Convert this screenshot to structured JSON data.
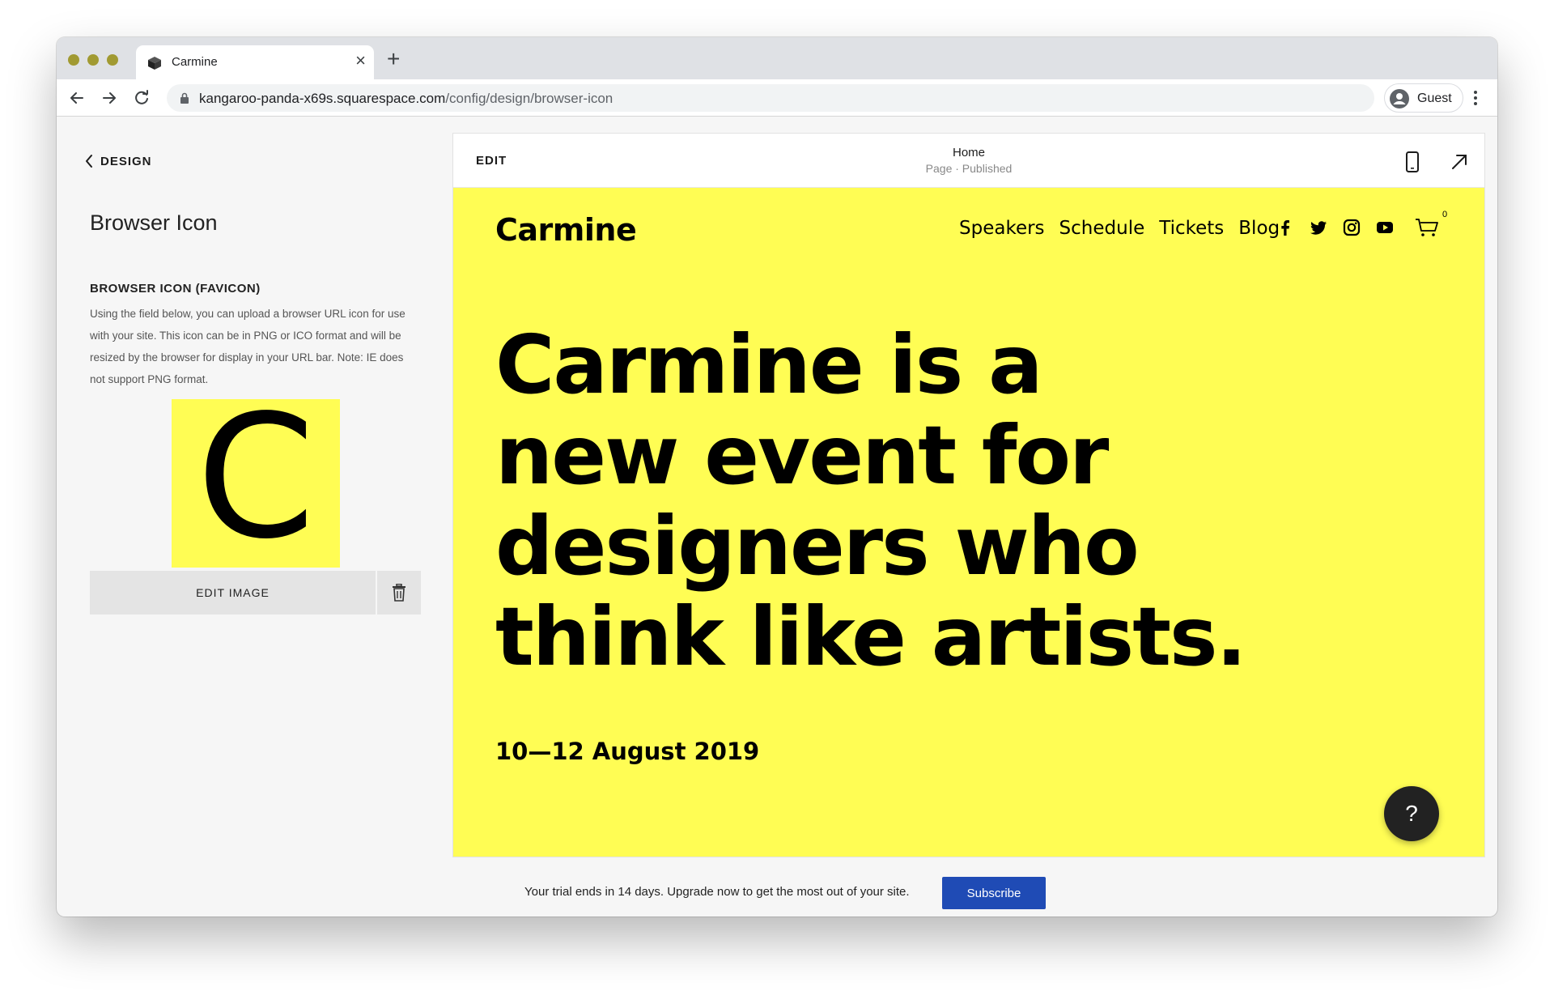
{
  "browser": {
    "tab_title": "Carmine",
    "url_host": "kangaroo-panda-x69s.squarespace.com",
    "url_path": "/config/design/browser-icon",
    "guest_label": "Guest",
    "traffic_light_color": "#a19a32"
  },
  "panel": {
    "back_label": "DESIGN",
    "title": "Browser Icon",
    "section_label": "BROWSER ICON (FAVICON)",
    "section_desc": "Using the field below, you can upload a browser URL icon for use with your site. This icon can be in PNG or ICO format and will be resized by the browser for display in your URL bar. Note: IE does not support PNG format.",
    "favicon_letter": "C",
    "favicon_bg": "#fffd54",
    "edit_image_label": "EDIT IMAGE",
    "delete_icon": "trash-icon"
  },
  "preview": {
    "edit_label": "EDIT",
    "page_title": "Home",
    "page_status": "Page · Published",
    "site_bg": "#fffd54"
  },
  "site": {
    "logo": "Carmine",
    "nav": [
      "Speakers",
      "Schedule",
      "Tickets",
      "Blog"
    ],
    "social_icons": [
      "facebook-icon",
      "twitter-icon",
      "instagram-icon",
      "youtube-icon"
    ],
    "cart_count": "0",
    "hero_lines": [
      "Carmine is a",
      "new event for",
      "designers who",
      "think like artists."
    ],
    "date": "10—12 August 2019",
    "help_label": "?"
  },
  "trial": {
    "text": "Your trial ends in 14 days. Upgrade now to get the most out of your site.",
    "subscribe_label": "Subscribe",
    "subscribe_color": "#1f4bb5"
  }
}
